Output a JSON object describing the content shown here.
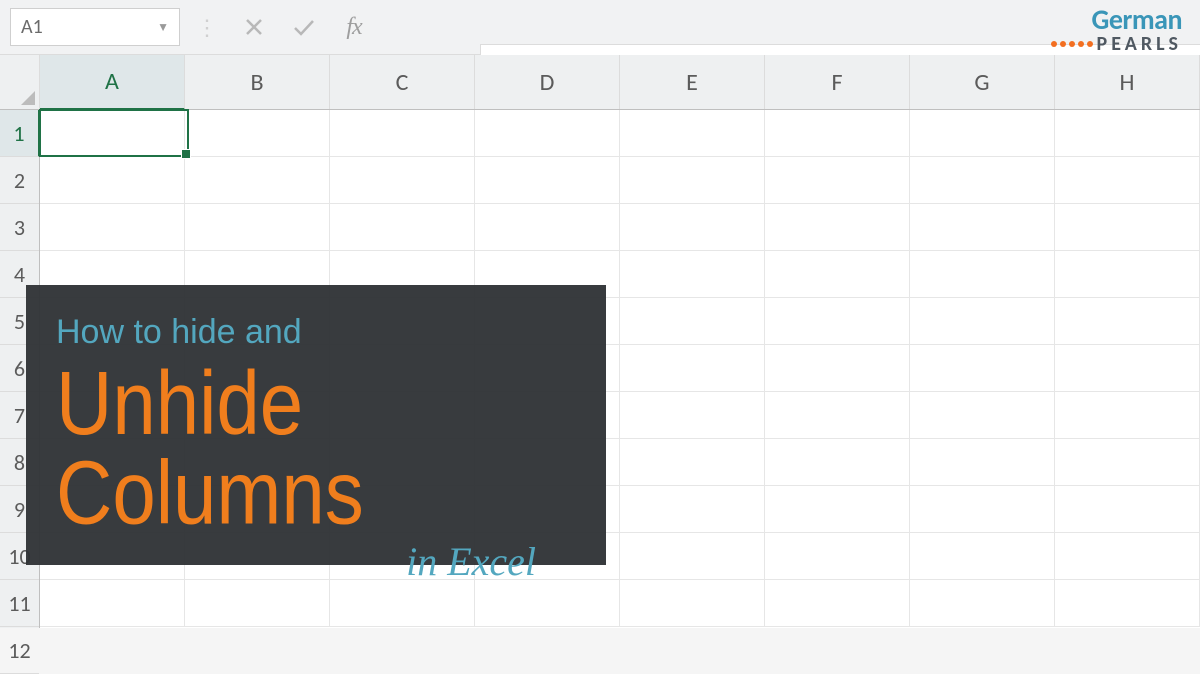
{
  "formula_bar": {
    "cell_reference": "A1",
    "fx_label": "fx"
  },
  "logo": {
    "word1": "German",
    "word2": "PEARLS"
  },
  "columns": [
    "A",
    "B",
    "C",
    "D",
    "E",
    "F",
    "G",
    "H"
  ],
  "rows": [
    "1",
    "2",
    "3",
    "4",
    "5",
    "6",
    "7",
    "8",
    "9",
    "10",
    "11",
    "12"
  ],
  "active_cell": "A1",
  "overlay": {
    "line1": "How to hide and",
    "line2": "Unhide Columns",
    "line3": "in Excel"
  }
}
